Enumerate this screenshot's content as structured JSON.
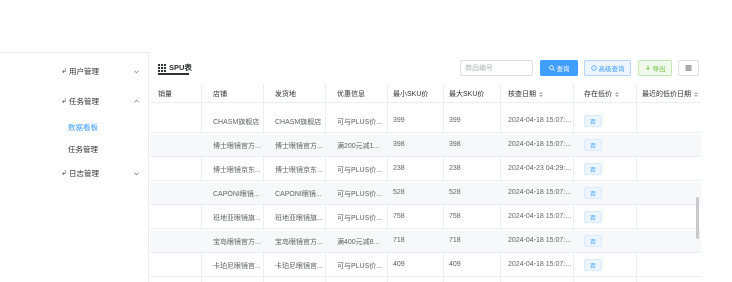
{
  "sidebar": {
    "items": [
      {
        "label": "用户管理",
        "icon": "user-icon",
        "expanded": false
      },
      {
        "label": "任务管理",
        "icon": "task-icon",
        "expanded": true
      },
      {
        "label": "日志管理",
        "icon": "log-icon",
        "expanded": false
      }
    ],
    "sub_items": [
      {
        "label": "数据看板",
        "active": true
      },
      {
        "label": "任务管理",
        "active": false
      }
    ]
  },
  "tab": {
    "title": "SPU表",
    "icon": "grid-icon"
  },
  "toolbar": {
    "search_placeholder": "商品编号",
    "query_label": "查询",
    "advanced_label": "高级查询",
    "export_label": "导出",
    "columns_icon": "columns-icon"
  },
  "colors": {
    "primary": "#409eff",
    "success": "#67c23a",
    "border": "#ebeef5",
    "stripe": "#f7f8fa"
  },
  "table": {
    "headers": [
      "销量",
      "店铺",
      "发货地",
      "优惠信息",
      "最小SKU价",
      "最大SKU价",
      "核查日期",
      "存在低价",
      "最近的低价日期"
    ],
    "sortable": [
      false,
      false,
      false,
      false,
      false,
      false,
      true,
      true,
      true
    ],
    "rows": [
      {
        "shop": "CHASM旗舰店",
        "ship": "CHASM旗舰店",
        "promo": "可与PLUS价...",
        "min": "399",
        "max": "399",
        "date": "2024-04-18 15:07:...",
        "low": "否"
      },
      {
        "shop": "博士眼镜官方...",
        "ship": "博士眼镜官方...",
        "promo": "满200元减1...",
        "min": "398",
        "max": "398",
        "date": "2024-04-18 15:07:...",
        "low": "否"
      },
      {
        "shop": "博士眼镜京东...",
        "ship": "博士眼镜京东...",
        "promo": "可与PLUS价...",
        "min": "238",
        "max": "238",
        "date": "2024-04-23 04:29:...",
        "low": "否"
      },
      {
        "shop": "CAPONI眼镜...",
        "ship": "CAPONI眼镜...",
        "promo": "可与PLUS价...",
        "min": "528",
        "max": "528",
        "date": "2024-04-18 15:07:...",
        "low": "否"
      },
      {
        "shop": "班地亚眼镜旗...",
        "ship": "班地亚眼镜旗...",
        "promo": "可与PLUS价...",
        "min": "758",
        "max": "758",
        "date": "2024-04-18 15:07:...",
        "low": "否"
      },
      {
        "shop": "宝岛眼镜官方...",
        "ship": "宝岛眼镜官方...",
        "promo": "满400元减8...",
        "min": "718",
        "max": "718",
        "date": "2024-04-18 15:07:...",
        "low": "否"
      },
      {
        "shop": "卡珀尼眼镜官...",
        "ship": "卡珀尼眼镜官...",
        "promo": "可与PLUS价...",
        "min": "409",
        "max": "409",
        "date": "2024-04-18 15:07:...",
        "low": "否"
      }
    ]
  }
}
